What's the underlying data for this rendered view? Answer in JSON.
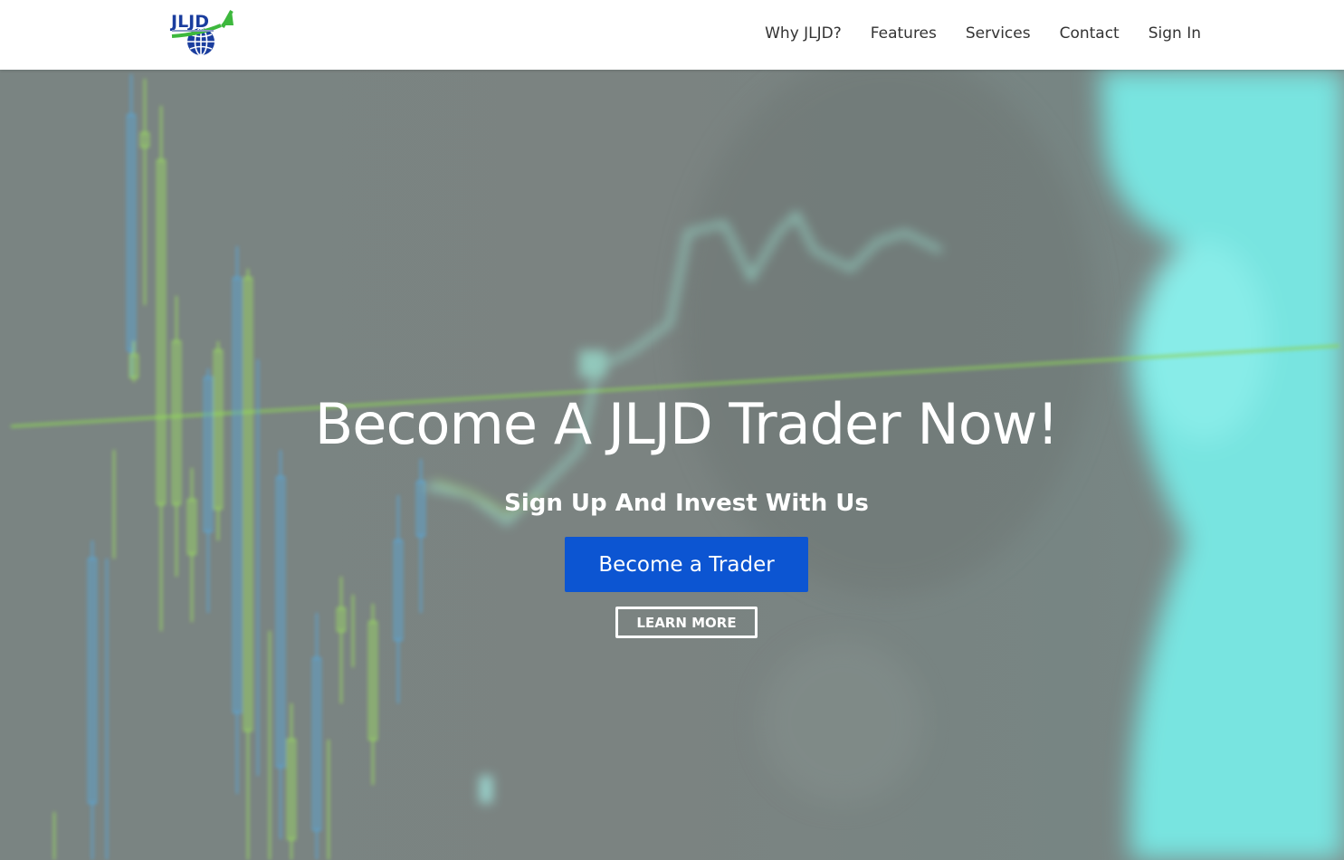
{
  "header": {
    "logo_text": "JLJD",
    "nav": [
      {
        "label": "Why JLJD?"
      },
      {
        "label": "Features"
      },
      {
        "label": "Services"
      },
      {
        "label": "Contact"
      },
      {
        "label": "Sign In"
      }
    ]
  },
  "hero": {
    "title": "Become A JLJD Trader Now!",
    "subtitle": "Sign Up And Invest With Us",
    "primary_button": "Become a Trader",
    "secondary_button": "LEARN MORE"
  },
  "colors": {
    "primary_button": "#0c55d2",
    "hero_overlay": "#7b8482",
    "accent_cyan": "#78e4e0",
    "logo_blue": "#1a3d9e",
    "logo_green": "#3db83d"
  }
}
